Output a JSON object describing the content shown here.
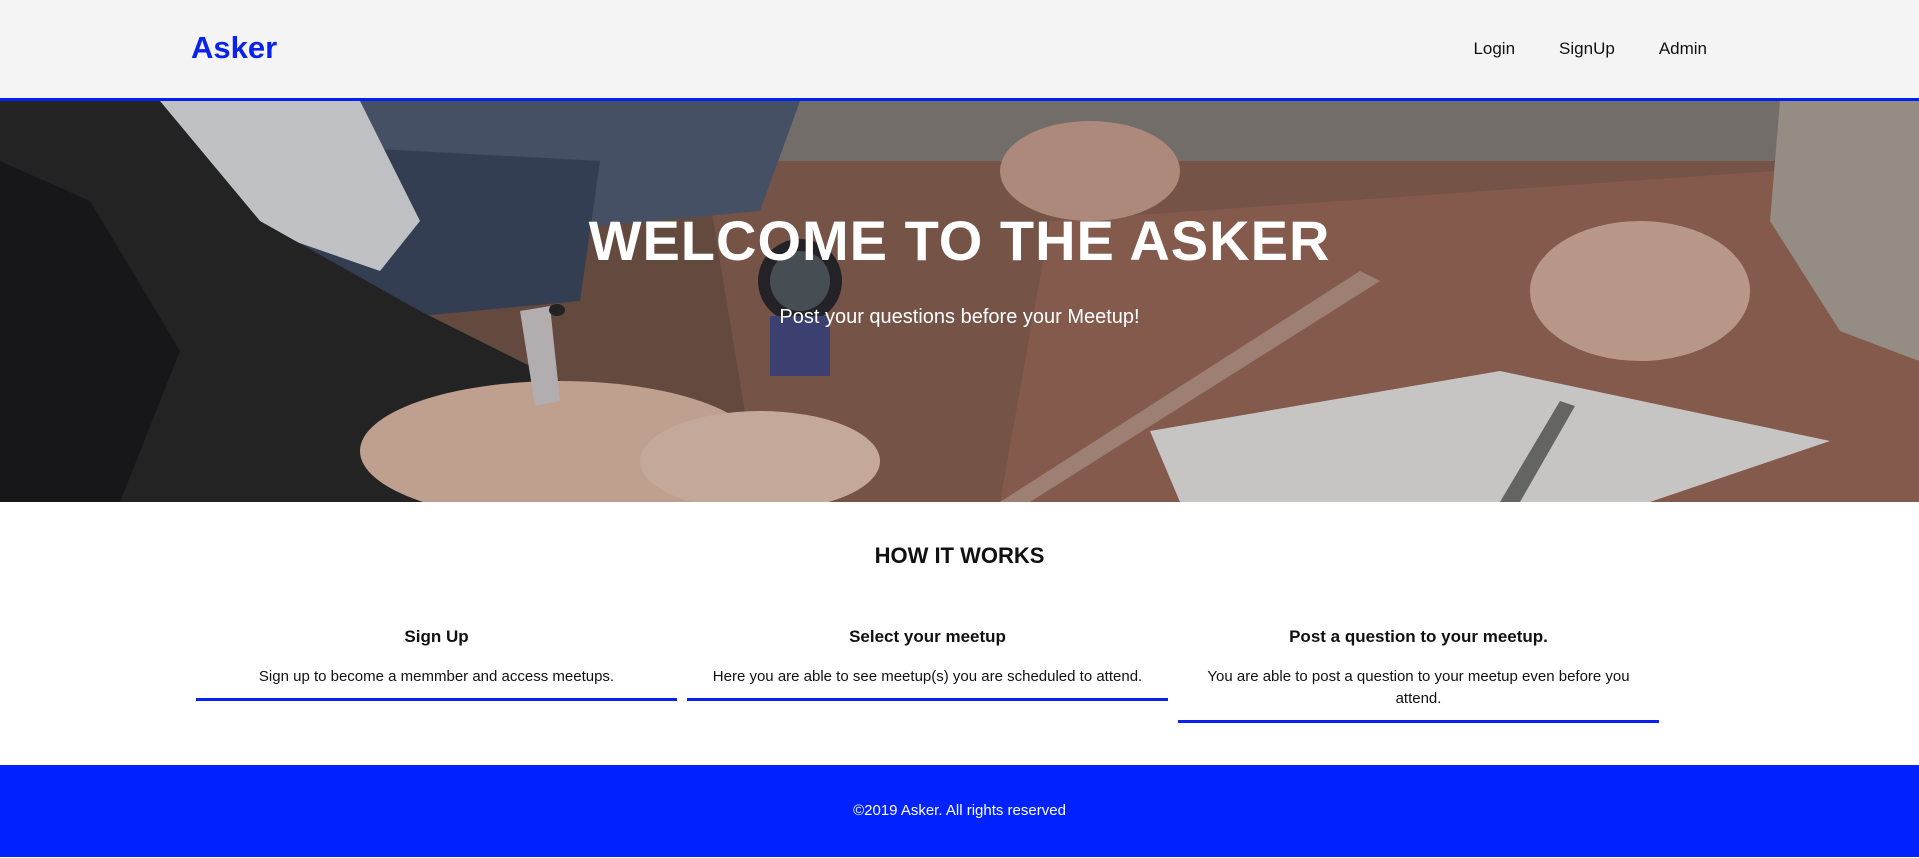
{
  "header": {
    "logo": "Asker",
    "nav": [
      {
        "label": "Login"
      },
      {
        "label": "SignUp"
      },
      {
        "label": "Admin"
      }
    ]
  },
  "hero": {
    "title": "WELCOME TO THE ASKER",
    "subtitle": "Post your questions before your Meetup!",
    "image": "meeting-table-photo"
  },
  "how_it_works": {
    "title": "HOW IT WORKS",
    "cards": [
      {
        "title": "Sign Up",
        "text": "Sign up to become a memmber and access meetups."
      },
      {
        "title": "Select your meetup",
        "text": "Here you are able to see meetup(s) you are scheduled to attend."
      },
      {
        "title": "Post a question to your meetup.",
        "text": "You are able to post a question to your meetup even before you attend."
      }
    ]
  },
  "footer": {
    "text": "©2019 Asker. All rights reserved"
  },
  "colors": {
    "accent": "#0a22ee",
    "footer_bg": "#0022ff",
    "header_bg": "#f4f4f4"
  }
}
